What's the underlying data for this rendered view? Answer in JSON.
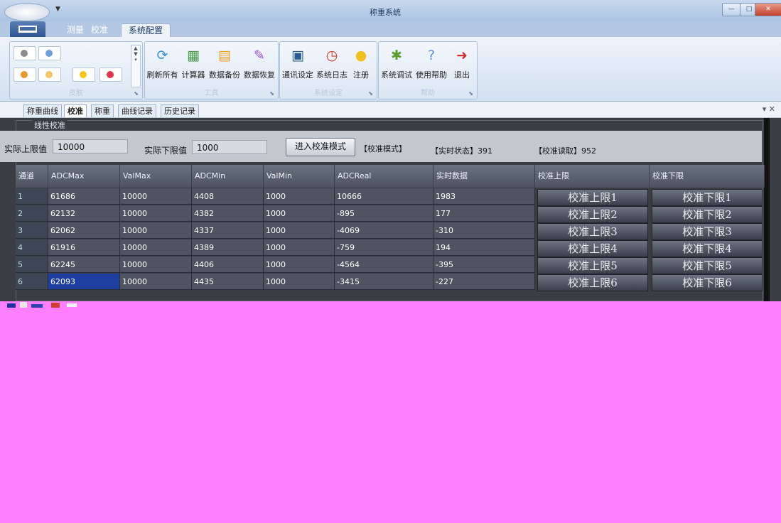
{
  "window": {
    "title": "称重系统",
    "controls": {
      "minimize": "—",
      "maximize": "□",
      "close": "✕"
    }
  },
  "ribbon": {
    "tabs": [
      {
        "label": "测量",
        "active": false
      },
      {
        "label": "校准",
        "active": false
      },
      {
        "label": "系统配置",
        "active": true
      }
    ],
    "groups": {
      "skin": {
        "title": "皮肤",
        "swatches": [
          "#8c8c8c",
          "#6fa0dc",
          "#e89a2a",
          "#f3c76a",
          "#f7c61c",
          "#e0354b"
        ]
      },
      "tools": {
        "title": "工具",
        "buttons": [
          {
            "label": "刷新所有",
            "icon": "refresh-icon"
          },
          {
            "label": "计算器",
            "icon": "calculator-icon"
          },
          {
            "label": "数据备份",
            "icon": "database-backup-icon"
          },
          {
            "label": "数据恢复",
            "icon": "data-restore-icon"
          }
        ]
      },
      "settings": {
        "title": "系统设定",
        "buttons": [
          {
            "label": "通讯设定",
            "icon": "communication-icon"
          },
          {
            "label": "系统日志",
            "icon": "log-clock-icon"
          },
          {
            "label": "注册",
            "icon": "lightbulb-icon"
          }
        ]
      },
      "help": {
        "title": "帮助",
        "buttons": [
          {
            "label": "系统调试",
            "icon": "debug-bug-icon"
          },
          {
            "label": "使用帮助",
            "icon": "help-question-icon"
          },
          {
            "label": "退出",
            "icon": "exit-door-icon"
          }
        ]
      }
    }
  },
  "doc_tabs": [
    {
      "label": "称重曲线",
      "active": false
    },
    {
      "label": "校准",
      "active": true
    },
    {
      "label": "称重",
      "active": false
    },
    {
      "label": "曲线记录",
      "active": false
    },
    {
      "label": "历史记录",
      "active": false
    }
  ],
  "doc_tabs_controls": "▾ ✕",
  "panel": {
    "group_label": "线性校准",
    "upper_label": "实际上限值",
    "upper_value": "10000",
    "lower_label": "实际下限值",
    "lower_value": "1000",
    "mode_button": "进入校准模式",
    "mode_status": "【校准模式】",
    "realtime_status": "【实时状态】391",
    "calib_read": "【校准读取】952"
  },
  "table": {
    "columns": [
      "通道",
      "ADCMax",
      "ValMax",
      "ADCMin",
      "ValMin",
      "ADCReal",
      "实时数据",
      "校准上限",
      "校准下限"
    ],
    "rows": [
      {
        "ch": "1",
        "adcmax": "61686",
        "valmax": "10000",
        "adcmin": "4408",
        "valmin": "1000",
        "adcreal": "10666",
        "realtime": "1983",
        "upper_btn": "校准上限1",
        "lower_btn": "校准下限1"
      },
      {
        "ch": "2",
        "adcmax": "62132",
        "valmax": "10000",
        "adcmin": "4382",
        "valmin": "1000",
        "adcreal": "-895",
        "realtime": "177",
        "upper_btn": "校准上限2",
        "lower_btn": "校准下限2"
      },
      {
        "ch": "3",
        "adcmax": "62062",
        "valmax": "10000",
        "adcmin": "4337",
        "valmin": "1000",
        "adcreal": "-4069",
        "realtime": "-310",
        "upper_btn": "校准上限3",
        "lower_btn": "校准下限3"
      },
      {
        "ch": "4",
        "adcmax": "61916",
        "valmax": "10000",
        "adcmin": "4389",
        "valmin": "1000",
        "adcreal": "-759",
        "realtime": "194",
        "upper_btn": "校准上限4",
        "lower_btn": "校准下限4"
      },
      {
        "ch": "5",
        "adcmax": "62245",
        "valmax": "10000",
        "adcmin": "4406",
        "valmin": "1000",
        "adcreal": "-4564",
        "realtime": "-395",
        "upper_btn": "校准上限5",
        "lower_btn": "校准下限5"
      },
      {
        "ch": "6",
        "adcmax": "62093",
        "valmax": "10000",
        "adcmin": "4435",
        "valmin": "1000",
        "adcreal": "-3415",
        "realtime": "-227",
        "upper_btn": "校准上限6",
        "lower_btn": "校准下限6"
      }
    ]
  }
}
